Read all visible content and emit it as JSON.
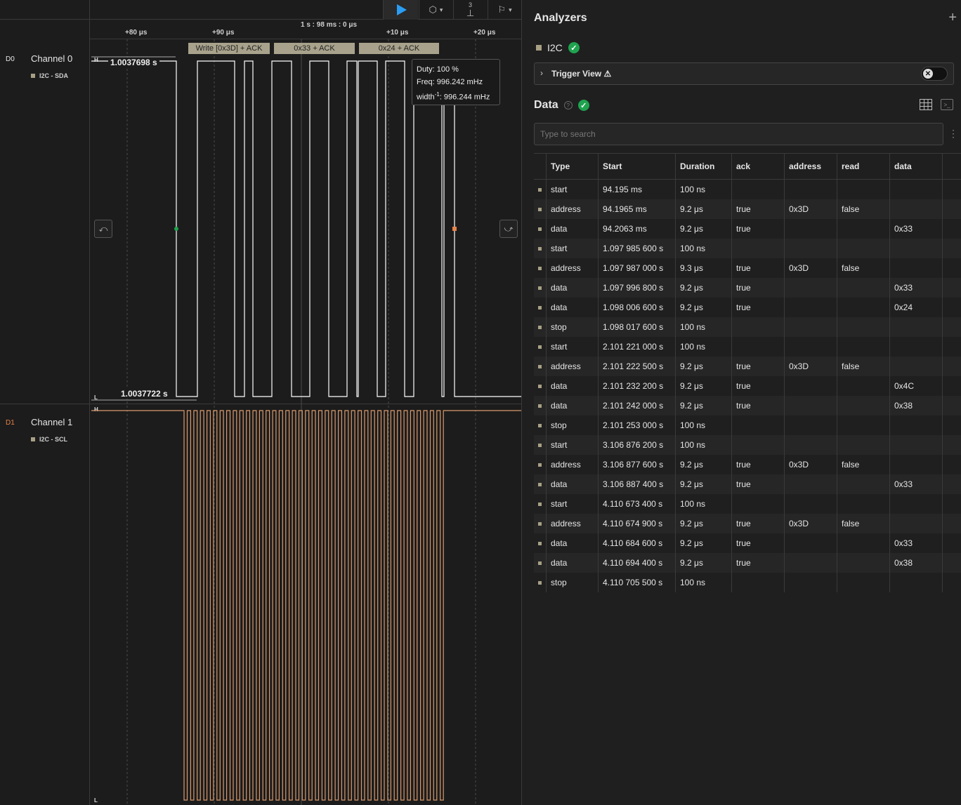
{
  "toolbar": {
    "play_icon": "play-icon",
    "trigger_icon": "trigger-mode-icon",
    "measure_badge": "3",
    "measure_icon": "measure-icon",
    "annotation_icon": "annotation-flag-icon"
  },
  "ruler": {
    "center_label": "1 s : 98 ms : 0 μs",
    "ticks": [
      "+80 μs",
      "+90 μs",
      "+10 μs",
      "+20 μs"
    ]
  },
  "channels": [
    {
      "code": "D0",
      "name": "Channel 0",
      "analyzer_label": "I2C - SDA",
      "color": "#ffffff",
      "code_color": "#e6e6e6",
      "high_marker": "H",
      "low_marker": "L"
    },
    {
      "code": "D1",
      "name": "Channel 1",
      "analyzer_label": "I2C - SCL",
      "color": "#d99a6c",
      "code_color": "#e8834a",
      "high_marker": "H",
      "low_marker": "L"
    }
  ],
  "protocol_frames": [
    "Write [0x3D] + ACK",
    "0x33 + ACK",
    "0x24 + ACK"
  ],
  "measurements": {
    "high_width": "1.0037698 s",
    "low_width": "1.0037722 s"
  },
  "tooltip": {
    "duty": "Duty: 100 %",
    "freq": "Freq: 996.242 mHz",
    "width_prefix": "width",
    "width_sup": "-1",
    "width_value": ": 996.244 mHz"
  },
  "panel": {
    "title": "Analyzers",
    "add_icon": "plus-icon",
    "analyzer_name": "I2C",
    "trigger_view_label": "Trigger View",
    "data_title": "Data",
    "search_placeholder": "Type to search",
    "accent_green": "#1fa34f"
  },
  "table": {
    "columns": [
      "Type",
      "Start",
      "Duration",
      "ack",
      "address",
      "read",
      "data"
    ],
    "rows": [
      [
        "start",
        "94.195 ms",
        "100 ns",
        "",
        "",
        "",
        ""
      ],
      [
        "address",
        "94.1965 ms",
        "9.2 μs",
        "true",
        "0x3D",
        "false",
        ""
      ],
      [
        "data",
        "94.2063 ms",
        "9.2 μs",
        "true",
        "",
        "",
        "0x33"
      ],
      [
        "start",
        "1.097 985 600 s",
        "100 ns",
        "",
        "",
        "",
        ""
      ],
      [
        "address",
        "1.097 987 000 s",
        "9.3 μs",
        "true",
        "0x3D",
        "false",
        ""
      ],
      [
        "data",
        "1.097 996 800 s",
        "9.2 μs",
        "true",
        "",
        "",
        "0x33"
      ],
      [
        "data",
        "1.098 006 600 s",
        "9.2 μs",
        "true",
        "",
        "",
        "0x24"
      ],
      [
        "stop",
        "1.098 017 600 s",
        "100 ns",
        "",
        "",
        "",
        ""
      ],
      [
        "start",
        "2.101 221 000 s",
        "100 ns",
        "",
        "",
        "",
        ""
      ],
      [
        "address",
        "2.101 222 500 s",
        "9.2 μs",
        "true",
        "0x3D",
        "false",
        ""
      ],
      [
        "data",
        "2.101 232 200 s",
        "9.2 μs",
        "true",
        "",
        "",
        "0x4C"
      ],
      [
        "data",
        "2.101 242 000 s",
        "9.2 μs",
        "true",
        "",
        "",
        "0x38"
      ],
      [
        "stop",
        "2.101 253 000 s",
        "100 ns",
        "",
        "",
        "",
        ""
      ],
      [
        "start",
        "3.106 876 200 s",
        "100 ns",
        "",
        "",
        "",
        ""
      ],
      [
        "address",
        "3.106 877 600 s",
        "9.2 μs",
        "true",
        "0x3D",
        "false",
        ""
      ],
      [
        "data",
        "3.106 887 400 s",
        "9.2 μs",
        "true",
        "",
        "",
        "0x33"
      ],
      [
        "start",
        "4.110 673 400 s",
        "100 ns",
        "",
        "",
        "",
        ""
      ],
      [
        "address",
        "4.110 674 900 s",
        "9.2 μs",
        "true",
        "0x3D",
        "false",
        ""
      ],
      [
        "data",
        "4.110 684 600 s",
        "9.2 μs",
        "true",
        "",
        "",
        "0x33"
      ],
      [
        "data",
        "4.110 694 400 s",
        "9.2 μs",
        "true",
        "",
        "",
        "0x38"
      ],
      [
        "stop",
        "4.110 705 500 s",
        "100 ns",
        "",
        "",
        "",
        ""
      ]
    ]
  }
}
